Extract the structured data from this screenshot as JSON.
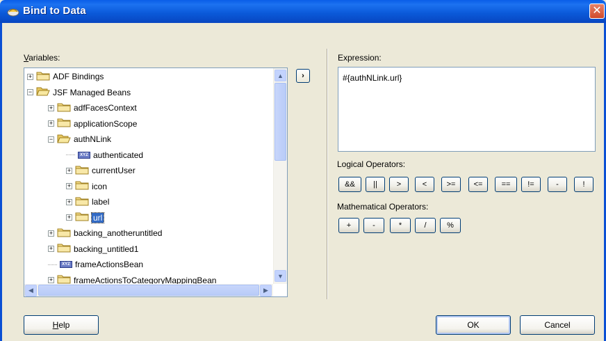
{
  "window": {
    "title": "Bind to Data",
    "close_glyph": "✕"
  },
  "variables": {
    "label": "Variables:",
    "label_mnemonic": "V",
    "label_rest": "ariables:",
    "tree": [
      {
        "label": "ADF Bindings",
        "expander": "+",
        "icon": "folder-icon"
      },
      {
        "label": "JSF Managed Beans",
        "expander": "−",
        "icon": "folder-open-icon"
      },
      {
        "label": "adfFacesContext",
        "expander": "+",
        "icon": "folder-icon"
      },
      {
        "label": "applicationScope",
        "expander": "+",
        "icon": "folder-icon"
      },
      {
        "label": "authNLink",
        "expander": "−",
        "icon": "folder-open-icon"
      },
      {
        "label": "authenticated",
        "expander": "",
        "icon": "variable-icon"
      },
      {
        "label": "currentUser",
        "expander": "+",
        "icon": "folder-icon"
      },
      {
        "label": "icon",
        "expander": "+",
        "icon": "folder-icon"
      },
      {
        "label": "label",
        "expander": "+",
        "icon": "folder-icon"
      },
      {
        "label": "url",
        "expander": "+",
        "icon": "folder-icon",
        "selected": true
      },
      {
        "label": "backing_anotheruntitled",
        "expander": "+",
        "icon": "folder-icon"
      },
      {
        "label": "backing_untitled1",
        "expander": "+",
        "icon": "folder-icon"
      },
      {
        "label": "frameActionsBean",
        "expander": "",
        "icon": "variable-icon"
      },
      {
        "label": "frameActionsToCategoryMappingBean",
        "expander": "+",
        "icon": "folder-icon"
      }
    ],
    "xyz_badge": "XYZ"
  },
  "move_button_glyph": "›",
  "expression": {
    "label": "Expression:",
    "value": "#{authNLink.url}"
  },
  "logical": {
    "label": "Logical Operators:",
    "ops": [
      "&&",
      "||",
      ">",
      "<",
      ">=",
      "<=",
      "==",
      "!=",
      "-",
      "!"
    ]
  },
  "math": {
    "label": "Mathematical Operators:",
    "ops": [
      "+",
      "-",
      "*",
      "/",
      "%"
    ]
  },
  "buttons": {
    "help_mnemonic": "H",
    "help_rest": "elp",
    "ok": "OK",
    "cancel": "Cancel"
  },
  "colors": {
    "title_bar": "#0a5ee8",
    "selection": "#316ac5",
    "dialog_bg": "#ece9d8"
  }
}
